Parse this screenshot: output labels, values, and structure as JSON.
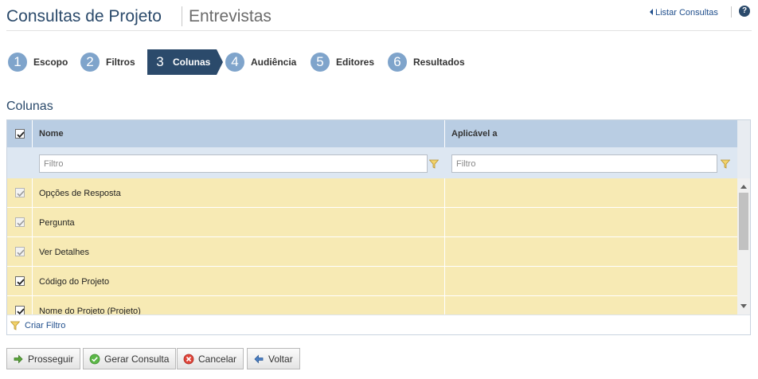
{
  "header": {
    "title": "Consultas de Projeto",
    "subtitle": "Entrevistas",
    "list_link": "Listar Consultas",
    "help_glyph": "?"
  },
  "steps": [
    {
      "num": "1",
      "label": "Escopo",
      "active": false
    },
    {
      "num": "2",
      "label": "Filtros",
      "active": false
    },
    {
      "num": "3",
      "label": "Colunas",
      "active": true
    },
    {
      "num": "4",
      "label": "Audiência",
      "active": false
    },
    {
      "num": "5",
      "label": "Editores",
      "active": false
    },
    {
      "num": "6",
      "label": "Resultados",
      "active": false
    }
  ],
  "section": {
    "title": "Colunas"
  },
  "grid": {
    "columns": [
      "Nome",
      "Aplicável a"
    ],
    "header_checked": true,
    "filter_placeholder": "Filtro",
    "rows": [
      {
        "name": "Opções de Resposta",
        "applies_to": "",
        "checked": true,
        "disabled": true
      },
      {
        "name": "Pergunta",
        "applies_to": "",
        "checked": true,
        "disabled": true
      },
      {
        "name": "Ver Detalhes",
        "applies_to": "",
        "checked": true,
        "disabled": true
      },
      {
        "name": "Código do Projeto",
        "applies_to": "",
        "checked": true,
        "disabled": false
      },
      {
        "name": "Nome do Projeto (Projeto)",
        "applies_to": "",
        "checked": true,
        "disabled": false
      }
    ],
    "create_filter": "Criar Filtro"
  },
  "buttons": {
    "proceed": "Prosseguir",
    "generate": "Gerar Consulta",
    "cancel": "Cancelar",
    "back": "Voltar"
  },
  "icons": {
    "list_link": "chevron-left-icon",
    "help": "help-icon",
    "filter": "funnel-icon",
    "proceed": "arrow-right-icon",
    "generate": "check-circle-icon",
    "cancel": "x-circle-icon",
    "back": "arrow-left-icon"
  },
  "colors": {
    "brand": "#2b4a6b",
    "step_circle": "#7fa4cb",
    "grid_header": "#b9cde3",
    "filter_row": "#dde7f2",
    "row_highlight": "#f7eab4",
    "link": "#1f4e8c"
  }
}
